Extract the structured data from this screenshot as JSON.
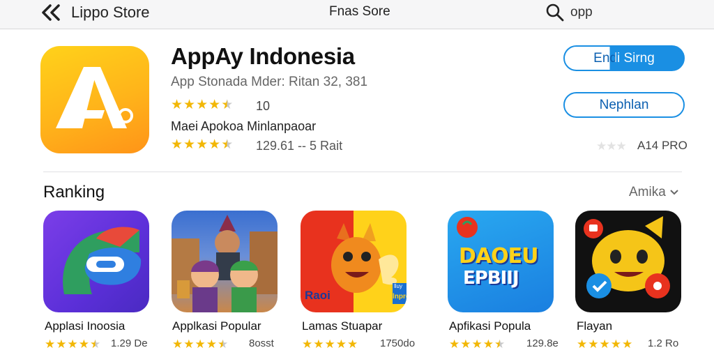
{
  "topbar": {
    "store_title": "Lippo Store",
    "center_title": "Fnas Sore",
    "search_text": "opp"
  },
  "app": {
    "title": "AppAy Indonesia",
    "subtitle": "App Stonada Mder: Ritan 32, 381",
    "rating": 4.5,
    "rating_count": "10",
    "description": "Maei Apokoa Minlanpaoar",
    "rating2": 4.5,
    "rating2_text": "129.61 -- 5 Rait",
    "primary_button": "Endi Sirng",
    "secondary_button": "Nephlan",
    "age_rating": "A14 PRO",
    "icon_letter": "A",
    "colors": {
      "accent": "#1a8fe3",
      "star": "#f2b705",
      "icon_gradient_top": "#ffd21a",
      "icon_gradient_bottom": "#ff9418"
    }
  },
  "ranking": {
    "title": "Ranking",
    "link_label": "Amika",
    "items": [
      {
        "name": "Applasi Inoosia",
        "rating": 4.5,
        "count": "1.29 De"
      },
      {
        "name": "Applkasi Popular",
        "rating": 4.5,
        "count": "8osst"
      },
      {
        "name": "Lamas Stuapar",
        "rating": 5,
        "count": "1750do"
      },
      {
        "name": "Apfikasi Popula",
        "rating": 4.5,
        "count": "129.8e"
      },
      {
        "name": "Flayan",
        "rating": 5,
        "count": "1.2 Ro"
      }
    ],
    "tile_texts": {
      "tile3_left": "Raoi",
      "tile3_sign_top": "lluy",
      "tile3_sign_bottom": "lnpre",
      "tile4_line1": "DAOEU",
      "tile4_line2": "EPBIIJ"
    }
  }
}
